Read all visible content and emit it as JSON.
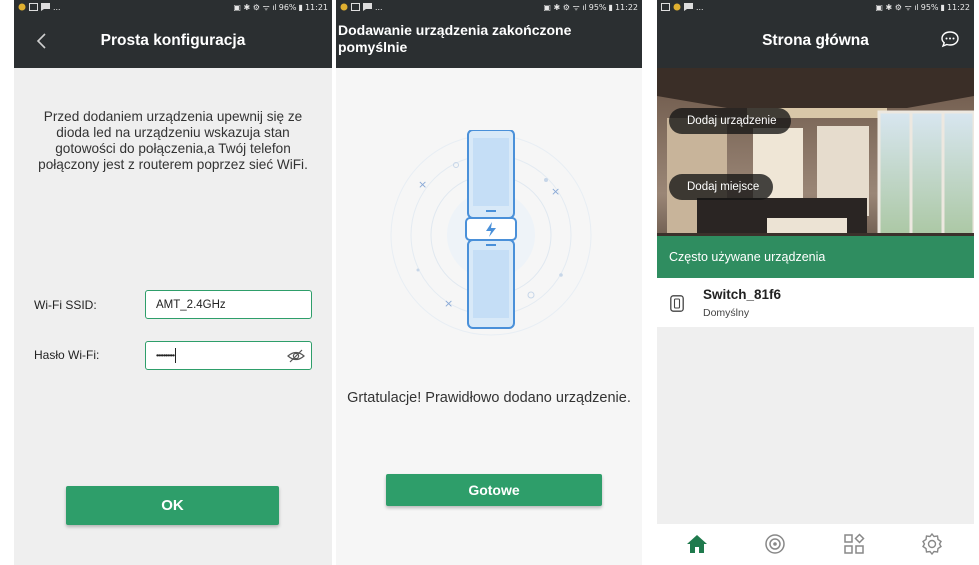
{
  "status_bars": [
    {
      "time": "11:21",
      "battery": "96%"
    },
    {
      "time": "11:22",
      "battery": "95%"
    },
    {
      "time": "11:22",
      "battery": "95%"
    }
  ],
  "screen1": {
    "title": "Prosta konfiguracja",
    "instructions": "Przed dodaniem urządzenia upewnij się ze dioda led na urządzeniu wskazuja stan gotowości do połączenia,a Twój telefon połączony jest z routerem poprzez sieć WiFi.",
    "ssid_label": "Wi-Fi SSID:",
    "ssid_value": "AMT_2.4GHz",
    "password_label": "Hasło Wi-Fi:",
    "password_value": "••••••••••",
    "ok_label": "OK"
  },
  "screen2": {
    "title": "Dodawanie urządzenia zakończone pomyślnie",
    "message": "Grtatulacje! Prawidłowo dodano urządzenie.",
    "done_label": "Gotowe"
  },
  "screen3": {
    "title": "Strona główna",
    "add_device_label": "Dodaj urządzenie",
    "add_place_label": "Dodaj miejsce",
    "frequent_devices_label": "Często używane urządzenia",
    "devices": [
      {
        "name": "Switch_81f6",
        "room": "Domyślny"
      }
    ]
  },
  "colors": {
    "accent": "#2e9e6a",
    "appbar": "#2b2f31",
    "background": "#efefef"
  }
}
